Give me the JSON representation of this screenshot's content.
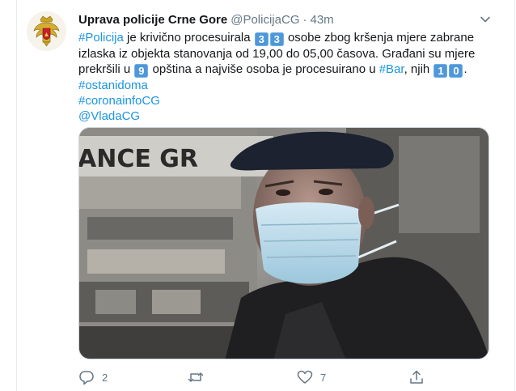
{
  "tweet": {
    "author": {
      "display_name": "Uprava policije Crne Gore",
      "handle": "@PolicijaCG",
      "separator": "·",
      "time": "43m",
      "avatar_icon": "coat-of-arms-icon"
    },
    "body": {
      "link_policija": "#Policija",
      "t1": " je krivično procesuirala ",
      "count1_a": "3",
      "count1_b": "3",
      "t2": " osobe zbog kršenja mjere zabrane izlaska iz objekta stanovanja od 19,00 do 05,00 časova. Građani su mjere prekršili u ",
      "count2": "9",
      "t3": " opština a najviše osoba je procesuirano u ",
      "link_bar": "#Bar",
      "t4": ", njih ",
      "count3_a": "1",
      "count3_b": "0",
      "t5": ".",
      "hashtag_ostanidoma": "#ostanidoma",
      "hashtag_coronainfo": "#coronainfoCG",
      "mention_vlada": "@VladaCG"
    },
    "media_partial_text": "ANCE GR",
    "actions": {
      "reply_count": "2",
      "retweet_count": "",
      "like_count": "7"
    }
  },
  "colors": {
    "link": "#1b95e0",
    "secondary_text": "#657786",
    "keycap": "#4e97d8"
  }
}
